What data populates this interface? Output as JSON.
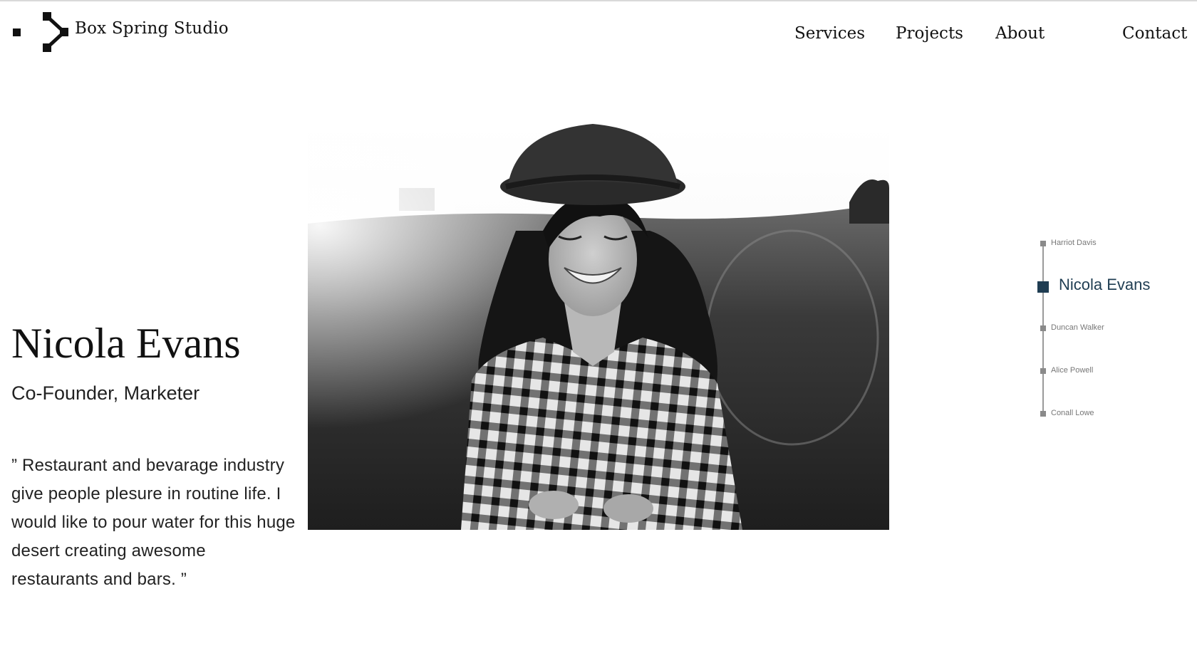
{
  "brand": {
    "name": "Box Spring Studio"
  },
  "nav": {
    "services": "Services",
    "projects": "Projects",
    "about": "About",
    "contact": "Contact"
  },
  "profile": {
    "name": "Nicola Evans",
    "role": "Co-Founder, Marketer",
    "quote": "” Restaurant and bevarage industry give people plesure in routine life. I would like to pour water for this huge desert creating awesome restaurants and bars. ”"
  },
  "team": [
    {
      "name": "Harriot Davis",
      "active": false
    },
    {
      "name": "Nicola Evans",
      "active": true
    },
    {
      "name": "Duncan Walker",
      "active": false
    },
    {
      "name": "Alice Powell",
      "active": false
    },
    {
      "name": "Conall Lowe",
      "active": false
    }
  ],
  "colors": {
    "accent": "#1f3d52",
    "timeline": "#9a9a9a",
    "text": "#111111"
  }
}
